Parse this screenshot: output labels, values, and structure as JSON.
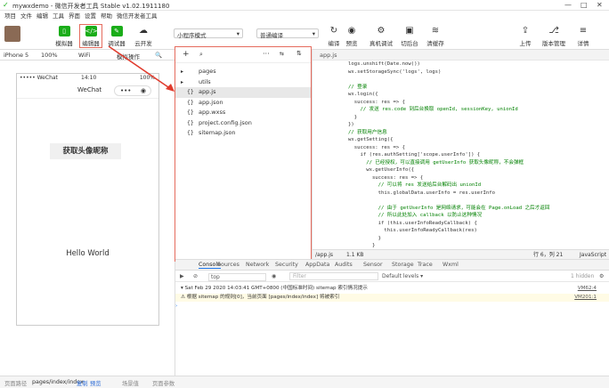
{
  "window": {
    "title": "mywxdemo - 微信开发者工具 Stable v1.02.1911180"
  },
  "menu": [
    "项目",
    "文件",
    "编辑",
    "工具",
    "界面",
    "设置",
    "帮助",
    "微信开发者工具"
  ],
  "toolbar": {
    "left": [
      {
        "label": "模拟器",
        "icon": "phone-icon"
      },
      {
        "label": "编辑器",
        "icon": "code-icon"
      },
      {
        "label": "调试器",
        "icon": "debug-icon"
      },
      {
        "label": "云开发",
        "icon": "cloud-icon"
      }
    ],
    "mode_select": "小程序模式",
    "compile_select": "普通编译",
    "mid": [
      {
        "label": "编译",
        "icon": "refresh-icon"
      },
      {
        "label": "预览",
        "icon": "eye-icon"
      },
      {
        "label": "真机调试",
        "icon": "remote-debug-icon"
      },
      {
        "label": "切后台",
        "icon": "background-icon"
      },
      {
        "label": "清缓存",
        "icon": "layers-icon"
      }
    ],
    "right": [
      {
        "label": "上传",
        "icon": "upload-icon"
      },
      {
        "label": "版本管理",
        "icon": "version-icon"
      },
      {
        "label": "详情",
        "icon": "menu-icon"
      }
    ]
  },
  "simulator": {
    "device": "iPhone 5",
    "zoom": "100%",
    "network": "WiFi",
    "ops": "模拟操作",
    "status_carrier": "••••• WeChat",
    "status_time": "14:10",
    "status_battery": "100%",
    "nav_title": "WeChat",
    "avatar_button": "获取头像昵称",
    "hello": "Hello World"
  },
  "explorer": {
    "files": [
      {
        "name": "pages",
        "icon": "folder-icon",
        "type": "folder"
      },
      {
        "name": "utils",
        "icon": "folder-icon",
        "type": "folder"
      },
      {
        "name": "app.js",
        "icon": "js-icon",
        "type": "file"
      },
      {
        "name": "app.json",
        "icon": "json-icon",
        "type": "file"
      },
      {
        "name": "app.wxss",
        "icon": "wxss-icon",
        "type": "file"
      },
      {
        "name": "project.config.json",
        "icon": "json-icon",
        "type": "file"
      },
      {
        "name": "sitemap.json",
        "icon": "json-icon",
        "type": "file"
      }
    ]
  },
  "editor": {
    "tab": "app.js",
    "lines": [
      "logs.unshift(Date.now())",
      "wx.setStorageSync('logs', logs)",
      "",
      "// 登录",
      "wx.login({",
      "  success: res => {",
      "    // 发送 res.code 到后台换取 openId, sessionKey, unionId",
      "  }",
      "})",
      "// 获取用户信息",
      "wx.getSetting({",
      "  success: res => {",
      "    if (res.authSetting['scope.userInfo']) {",
      "      // 已经授权，可以直接调用 getUserInfo 获取头像昵称，不会弹框",
      "      wx.getUserInfo({",
      "        success: res => {",
      "          // 可以将 res 发送给后台解码出 unionId",
      "          this.globalData.userInfo = res.userInfo",
      "",
      "          // 由于 getUserInfo 是网络请求，可能会在 Page.onLoad 之后才返回",
      "          // 所以此处加入 callback 以防止这种情况",
      "          if (this.userInfoReadyCallback) {",
      "            this.userInfoReadyCallback(res)",
      "          }",
      "        }"
    ],
    "file": "/app.js",
    "size": "1.1 KB",
    "cursor": "行 6，列 21",
    "lang": "JavaScript"
  },
  "console": {
    "tabs": [
      "Console",
      "Sources",
      "Network",
      "Security",
      "AppData",
      "Audits",
      "Sensor",
      "Storage",
      "Trace",
      "Wxml"
    ],
    "context": "top",
    "filter_placeholder": "Filter",
    "levels": "Default levels ▾",
    "hidden": "1 hidden",
    "logs": [
      {
        "text": "▾ Sat Feb 29 2020 14:03:41 GMT+0800 (中国标准时间) sitemap 索引情况提示",
        "src": "VM62:4"
      },
      {
        "text": "⚠ 根据 sitemap 的规则[0]，当前页面 [pages/index/index] 将被索引",
        "src": "VM201:1"
      }
    ]
  },
  "bottom": {
    "path_label": "页面路径",
    "path": "pages/index/index",
    "copy": "复制",
    "preview": "预览",
    "scene": "场景值",
    "params": "页面参数"
  }
}
